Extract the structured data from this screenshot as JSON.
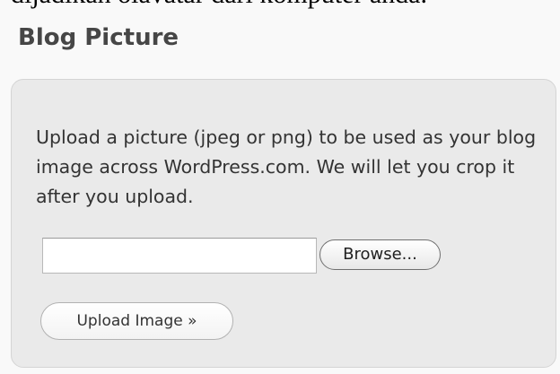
{
  "header_fragment": "dijadikan olavatar dari komputer anda.",
  "section": {
    "title": "Blog Picture"
  },
  "panel": {
    "description": "Upload a picture (jpeg or png) to be used as your blog image across WordPress.com. We will let you crop it after you upload.",
    "file_input_value": "",
    "browse_label": "Browse...",
    "upload_label": "Upload Image »"
  }
}
